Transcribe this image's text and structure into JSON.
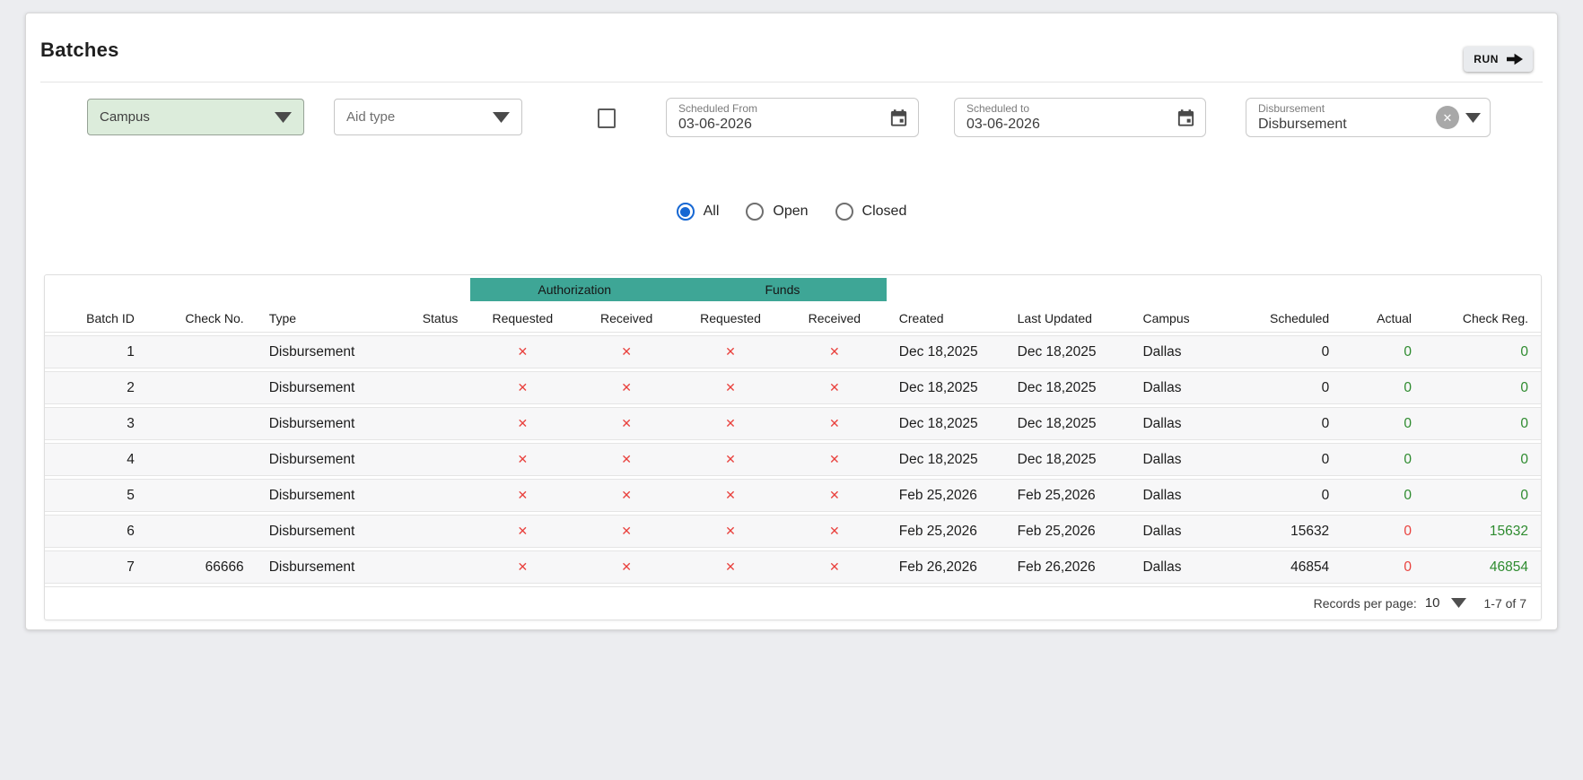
{
  "page": {
    "title": "Batches"
  },
  "toolbar": {
    "run_label": "RUN"
  },
  "filters": {
    "campus": {
      "label": "Campus"
    },
    "aid_type": {
      "label": "Aid type"
    },
    "scheduled_from": {
      "label": "Scheduled From",
      "value": "03-06-2026"
    },
    "scheduled_to": {
      "label": "Scheduled to",
      "value": "03-06-2026"
    },
    "disbursement": {
      "label": "Disbursement",
      "value": "Disbursement"
    }
  },
  "status_filter": {
    "options": [
      {
        "label": "All",
        "selected": true
      },
      {
        "label": "Open",
        "selected": false
      },
      {
        "label": "Closed",
        "selected": false
      }
    ]
  },
  "icons": {
    "cross": "✕"
  },
  "colors": {
    "teal_group_header": "#3ea696",
    "campus_filter_bg": "#dcecdb",
    "cross_red": "#e9423e",
    "positive_green": "#2e8b2f",
    "radio_blue": "#1667d3"
  },
  "table": {
    "group_headers": [
      {
        "label": "Authorization"
      },
      {
        "label": "Funds"
      }
    ],
    "columns": [
      "Batch ID",
      "Check No.",
      "Type",
      "Status",
      "Requested",
      "Received",
      "Requested",
      "Received",
      "Created",
      "Last Updated",
      "Campus",
      "Scheduled",
      "Actual",
      "Check Reg."
    ],
    "rows": [
      {
        "batch_id": "1",
        "check_no": "",
        "type": "Disbursement",
        "status": "",
        "authorization": {
          "requested": "✕",
          "received": "✕"
        },
        "funds": {
          "requested": "✕",
          "received": "✕"
        },
        "created": "Dec 18,2025",
        "last_updated": "Dec 18,2025",
        "campus": "Dallas",
        "scheduled": "0",
        "actual": "0",
        "actual_color": "#2e8b2f",
        "check_reg": "0",
        "check_reg_color": "#2e8b2f"
      },
      {
        "batch_id": "2",
        "check_no": "",
        "type": "Disbursement",
        "status": "",
        "authorization": {
          "requested": "✕",
          "received": "✕"
        },
        "funds": {
          "requested": "✕",
          "received": "✕"
        },
        "created": "Dec 18,2025",
        "last_updated": "Dec 18,2025",
        "campus": "Dallas",
        "scheduled": "0",
        "actual": "0",
        "actual_color": "#2e8b2f",
        "check_reg": "0",
        "check_reg_color": "#2e8b2f"
      },
      {
        "batch_id": "3",
        "check_no": "",
        "type": "Disbursement",
        "status": "",
        "authorization": {
          "requested": "✕",
          "received": "✕"
        },
        "funds": {
          "requested": "✕",
          "received": "✕"
        },
        "created": "Dec 18,2025",
        "last_updated": "Dec 18,2025",
        "campus": "Dallas",
        "scheduled": "0",
        "actual": "0",
        "actual_color": "#2e8b2f",
        "check_reg": "0",
        "check_reg_color": "#2e8b2f"
      },
      {
        "batch_id": "4",
        "check_no": "",
        "type": "Disbursement",
        "status": "",
        "authorization": {
          "requested": "✕",
          "received": "✕"
        },
        "funds": {
          "requested": "✕",
          "received": "✕"
        },
        "created": "Dec 18,2025",
        "last_updated": "Dec 18,2025",
        "campus": "Dallas",
        "scheduled": "0",
        "actual": "0",
        "actual_color": "#2e8b2f",
        "check_reg": "0",
        "check_reg_color": "#2e8b2f"
      },
      {
        "batch_id": "5",
        "check_no": "",
        "type": "Disbursement",
        "status": "",
        "authorization": {
          "requested": "✕",
          "received": "✕"
        },
        "funds": {
          "requested": "✕",
          "received": "✕"
        },
        "created": "Feb 25,2026",
        "last_updated": "Feb 25,2026",
        "campus": "Dallas",
        "scheduled": "0",
        "actual": "0",
        "actual_color": "#2e8b2f",
        "check_reg": "0",
        "check_reg_color": "#2e8b2f"
      },
      {
        "batch_id": "6",
        "check_no": "",
        "type": "Disbursement",
        "status": "",
        "authorization": {
          "requested": "✕",
          "received": "✕"
        },
        "funds": {
          "requested": "✕",
          "received": "✕"
        },
        "created": "Feb 25,2026",
        "last_updated": "Feb 25,2026",
        "campus": "Dallas",
        "scheduled": "15632",
        "actual": "0",
        "actual_color": "#e9423e",
        "check_reg": "15632",
        "check_reg_color": "#2e8b2f"
      },
      {
        "batch_id": "7",
        "check_no": "66666",
        "type": "Disbursement",
        "status": "",
        "authorization": {
          "requested": "✕",
          "received": "✕"
        },
        "funds": {
          "requested": "✕",
          "received": "✕"
        },
        "created": "Feb 26,2026",
        "last_updated": "Feb 26,2026",
        "campus": "Dallas",
        "scheduled": "46854",
        "actual": "0",
        "actual_color": "#e9423e",
        "check_reg": "46854",
        "check_reg_color": "#2e8b2f"
      }
    ],
    "footer": {
      "records_per_page_label": "Records per page:",
      "records_per_page_value": "10",
      "range_label": "1-7 of 7"
    }
  }
}
